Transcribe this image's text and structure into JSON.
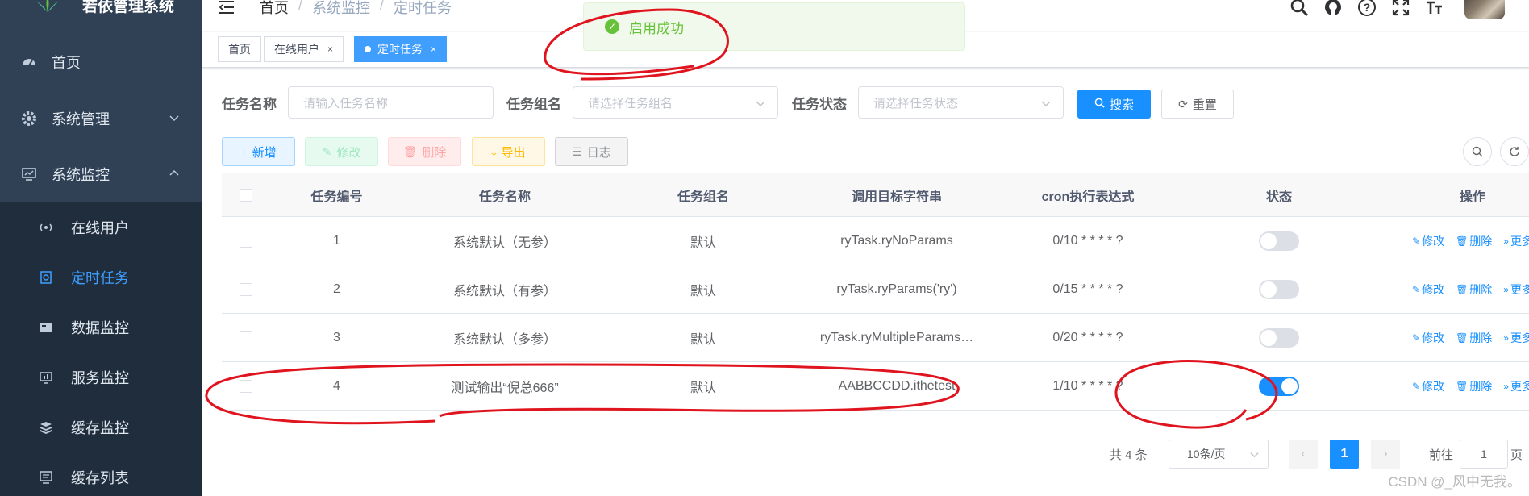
{
  "app": {
    "title": "若依管理系统"
  },
  "sidebar": {
    "items": [
      {
        "label": "首页",
        "icon": "dashboard-icon"
      },
      {
        "label": "系统管理",
        "icon": "gear-icon"
      },
      {
        "label": "系统监控",
        "icon": "monitor-icon"
      }
    ],
    "submenu": [
      {
        "label": "在线用户",
        "icon": "online-icon"
      },
      {
        "label": "定时任务",
        "icon": "job-icon",
        "active": true
      },
      {
        "label": "数据监控",
        "icon": "druid-icon"
      },
      {
        "label": "服务监控",
        "icon": "server-icon"
      },
      {
        "label": "缓存监控",
        "icon": "redis-icon"
      },
      {
        "label": "缓存列表",
        "icon": "redis-list-icon"
      }
    ]
  },
  "breadcrumb": {
    "home": "首页",
    "parent": "系统监控",
    "current": "定时任务"
  },
  "tags": [
    {
      "label": "首页"
    },
    {
      "label": "在线用户",
      "close": "×"
    },
    {
      "label": "定时任务",
      "close": "×"
    }
  ],
  "toast": {
    "message": "启用成功"
  },
  "search": {
    "job_name_label": "任务名称",
    "job_name_placeholder": "请输入任务名称",
    "job_group_label": "任务组名",
    "job_group_placeholder": "请选择任务组名",
    "status_label": "任务状态",
    "status_placeholder": "请选择任务状态",
    "search_btn": "搜索",
    "reset_btn": "重置"
  },
  "toolbar": {
    "add": "新增",
    "edit": "修改",
    "delete": "删除",
    "export": "导出",
    "log": "日志"
  },
  "table": {
    "headers": [
      "任务编号",
      "任务名称",
      "任务组名",
      "调用目标字符串",
      "cron执行表达式",
      "状态",
      "操作"
    ],
    "rows": [
      {
        "id": "1",
        "name": "系统默认（无参）",
        "group": "默认",
        "target": "ryTask.ryNoParams",
        "cron": "0/10 * * * * ?",
        "enabled": false
      },
      {
        "id": "2",
        "name": "系统默认（有参）",
        "group": "默认",
        "target": "ryTask.ryParams('ry')",
        "cron": "0/15 * * * * ?",
        "enabled": false
      },
      {
        "id": "3",
        "name": "系统默认（多参）",
        "group": "默认",
        "target": "ryTask.ryMultipleParams…",
        "cron": "0/20 * * * * ?",
        "enabled": false
      },
      {
        "id": "4",
        "name": "测试输出“倪总666”",
        "group": "默认",
        "target": "AABBCCDD.ithetest",
        "cron": "1/10 * * * * ?",
        "enabled": true
      }
    ],
    "ops": {
      "edit": "修改",
      "delete": "删除",
      "more": "更多"
    }
  },
  "pagination": {
    "total": "共 4 条",
    "page_size": "10条/页",
    "current_page": "1",
    "goto_label": "前往",
    "goto_value": "1",
    "page_suffix": "页"
  },
  "watermark": "CSDN @_风中无我。",
  "colors": {
    "sidebar_bg": "#304156",
    "submenu_bg": "#1f2d3d",
    "primary": "#1890ff",
    "success": "#67c23a",
    "annotation": "#e0141e"
  }
}
